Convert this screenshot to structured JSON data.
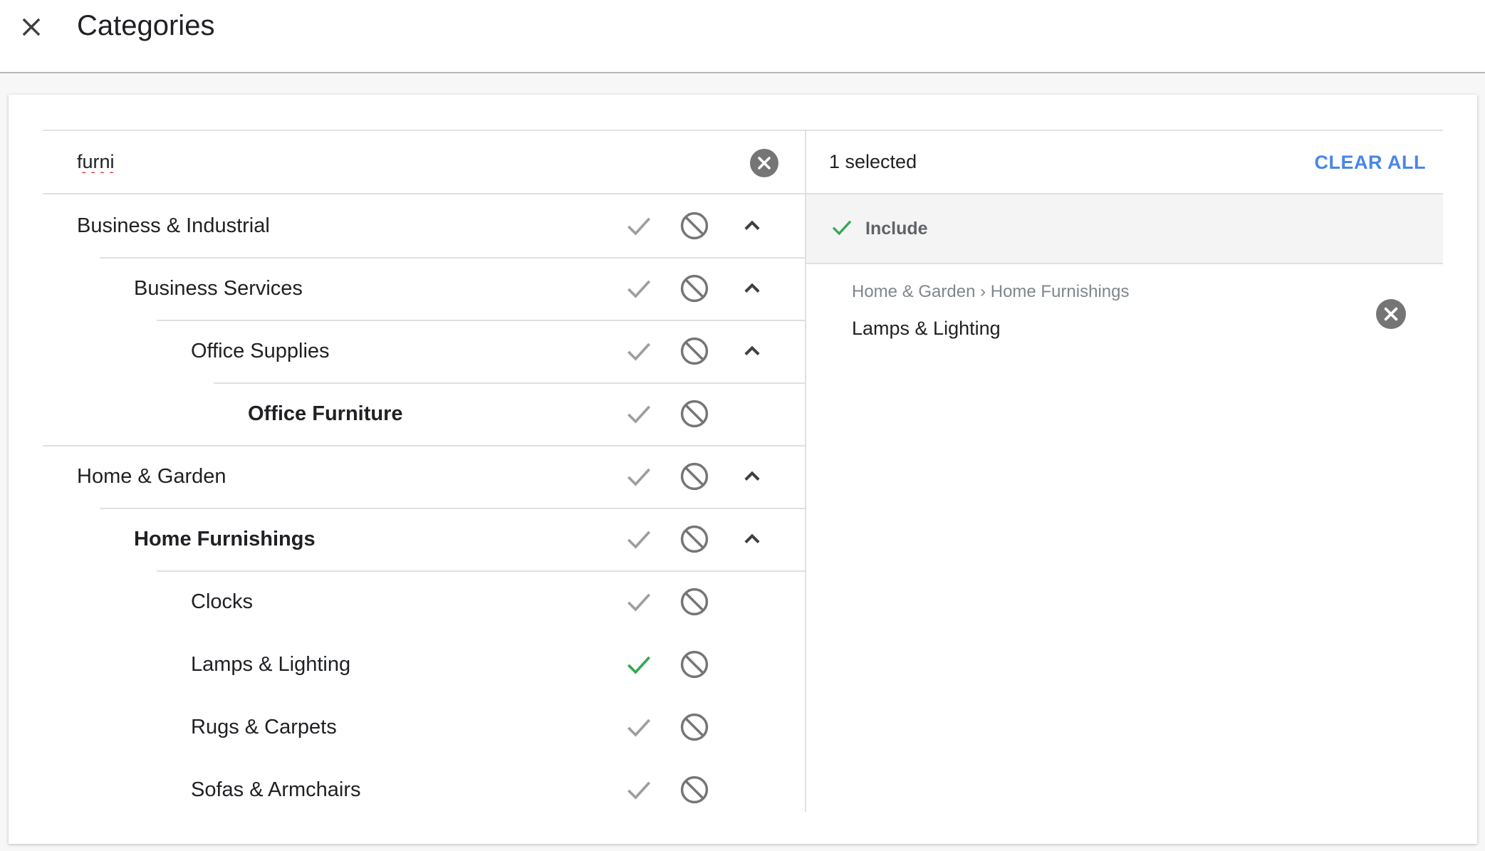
{
  "header": {
    "title": "Categories",
    "close_icon": "close-icon"
  },
  "search": {
    "value": "furni",
    "clear_icon": "cancel-circle-icon"
  },
  "tree": [
    {
      "label": "Business & Industrial",
      "level": 0,
      "bold": false,
      "included": false,
      "expandable": true
    },
    {
      "label": "Business Services",
      "level": 1,
      "bold": false,
      "included": false,
      "expandable": true
    },
    {
      "label": "Office Supplies",
      "level": 2,
      "bold": false,
      "included": false,
      "expandable": true
    },
    {
      "label": "Office Furniture",
      "level": 3,
      "bold": true,
      "included": false,
      "expandable": false
    },
    {
      "label": "Home & Garden",
      "level": 0,
      "bold": false,
      "included": false,
      "expandable": true
    },
    {
      "label": "Home Furnishings",
      "level": 1,
      "bold": true,
      "included": false,
      "expandable": true
    },
    {
      "label": "Clocks",
      "level": 2,
      "bold": false,
      "included": false,
      "expandable": false
    },
    {
      "label": "Lamps & Lighting",
      "level": 2,
      "bold": false,
      "included": true,
      "expandable": false
    },
    {
      "label": "Rugs & Carpets",
      "level": 2,
      "bold": false,
      "included": false,
      "expandable": false
    },
    {
      "label": "Sofas & Armchairs",
      "level": 2,
      "bold": false,
      "included": false,
      "expandable": false
    }
  ],
  "selection": {
    "count_label": "1 selected",
    "clear_all_label": "CLEAR ALL",
    "group_label": "Include",
    "items": [
      {
        "path": "Home & Garden › Home Furnishings",
        "name": "Lamps & Lighting"
      }
    ]
  },
  "colors": {
    "accent_blue": "#4a86e8",
    "include_green": "#34a853",
    "icon_gray": "#9e9e9e",
    "circle_gray": "#757575"
  }
}
